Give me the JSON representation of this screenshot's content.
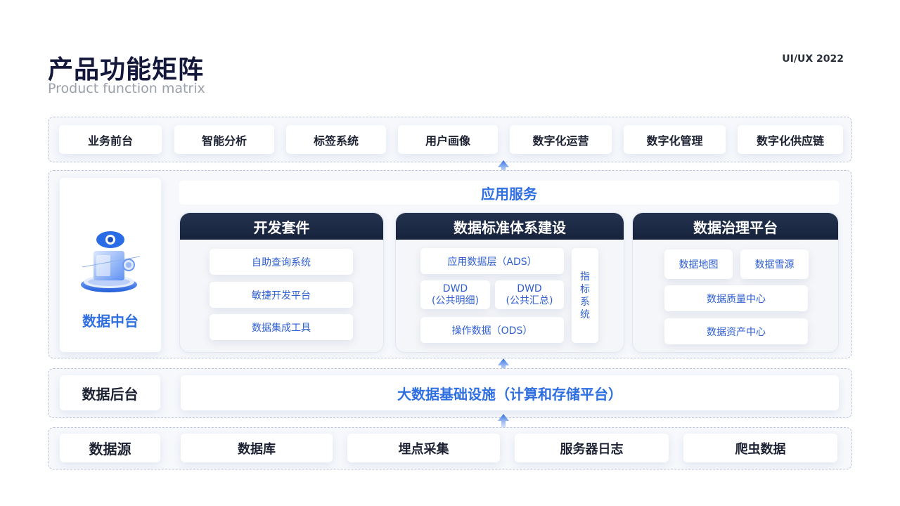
{
  "header": {
    "title": "产品功能矩阵",
    "subtitle": "Product function matrix",
    "tag": "UI/UX 2022"
  },
  "top_row": [
    "业务前台",
    "智能分析",
    "标签系统",
    "用户画像",
    "数字化运营",
    "数字化管理",
    "数字化供应链"
  ],
  "middle": {
    "label": "数据中台",
    "icon": "data-platform-icon",
    "service_title": "应用服务",
    "dev_suite": {
      "title": "开发套件",
      "items": [
        "自助查询系统",
        "敏捷开发平台",
        "数据集成工具"
      ]
    },
    "standards": {
      "title": "数据标准体系建设",
      "ads": "应用数据层（ADS）",
      "dwd1_a": "DWD",
      "dwd1_b": "(公共明细)",
      "dwd2_a": "DWD",
      "dwd2_b": "(公共汇总)",
      "ods": "操作数据（ODS）",
      "side": [
        "指",
        "标",
        "系",
        "统"
      ]
    },
    "governance": {
      "title": "数据治理平台",
      "items": [
        "数据地图",
        "数据雪源",
        "数据质量中心",
        "数据资产中心"
      ]
    }
  },
  "backend": {
    "label": "数据后台",
    "infra": "大数据基础设施（计算和存储平台）"
  },
  "source": {
    "label": "数据源",
    "items": [
      "数据库",
      "埋点采集",
      "服务器日志",
      "爬虫数据"
    ]
  },
  "colors": {
    "accent": "#2f6fe0",
    "dark_header": "#1b2742",
    "text_dark": "#14183a"
  }
}
